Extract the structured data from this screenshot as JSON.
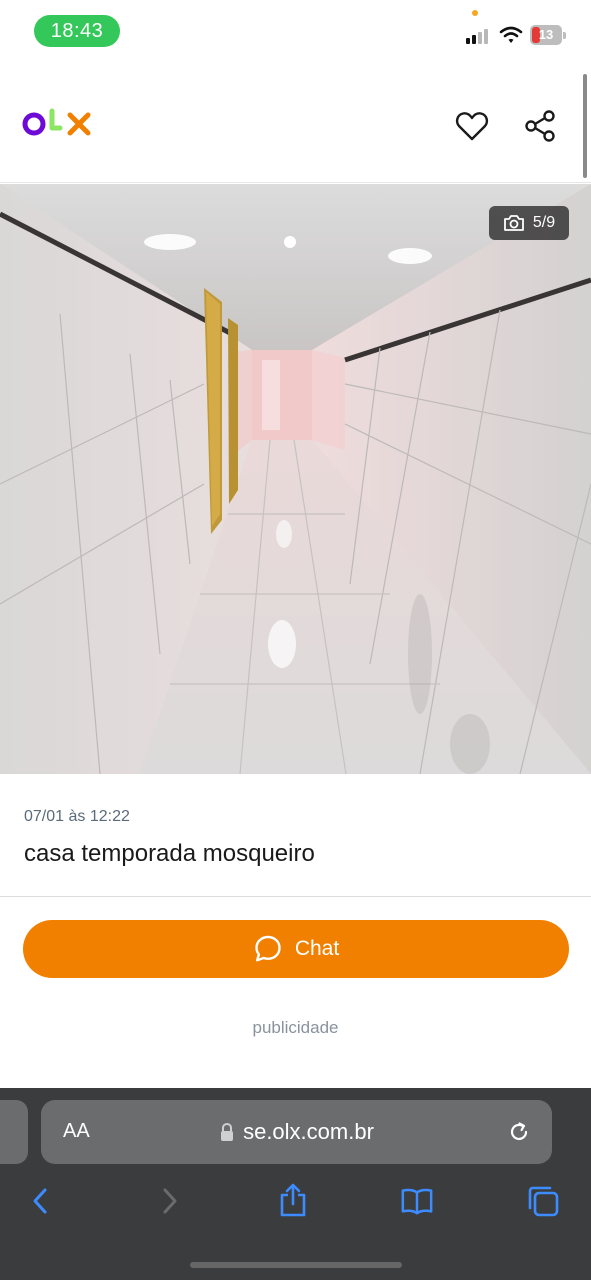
{
  "status_bar": {
    "time": "18:43",
    "battery_level": "13",
    "colors": {
      "time_pill": "#34c759",
      "battery_low": "#e53935"
    }
  },
  "header": {
    "logo_letters": [
      "o",
      "L",
      "x"
    ],
    "logo_colors": [
      "#6e0ad6",
      "#8ce563",
      "#f28000"
    ],
    "favorite_icon": "heart-icon",
    "share_icon": "share-icon"
  },
  "gallery": {
    "counter": "5/9",
    "counter_icon": "camera-icon",
    "current_index": 5,
    "total": 9
  },
  "listing": {
    "date": "07/01 às 12:22",
    "title": "casa temporada mosqueiro"
  },
  "actions": {
    "chat_label": "Chat",
    "chat_icon": "chat-bubble-icon",
    "accent_color": "#f28000"
  },
  "ad": {
    "label": "publicidade"
  },
  "browser": {
    "text_size_label": "AA",
    "url": "se.olx.com.br",
    "lock_icon": "lock-icon",
    "reload_icon": "reload-icon",
    "toolbar_icons": [
      "back-icon",
      "forward-icon",
      "share-icon",
      "bookmarks-icon",
      "tabs-icon"
    ]
  }
}
